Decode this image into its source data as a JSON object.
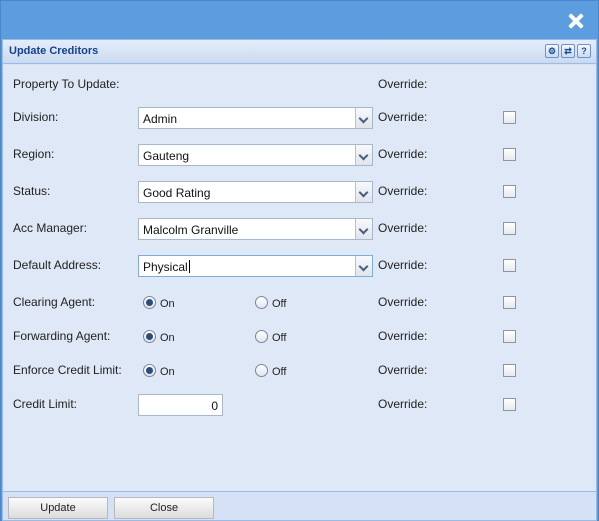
{
  "window": {
    "close_icon": "close-icon"
  },
  "panel": {
    "title": "Update Creditors",
    "tools": [
      {
        "icon": "gear-icon",
        "glyph": "⚙"
      },
      {
        "icon": "refresh-icon",
        "glyph": "⇄"
      },
      {
        "icon": "help-icon",
        "glyph": "?"
      }
    ]
  },
  "form": {
    "header_label": "Property To Update:",
    "override_label": "Override:",
    "division": {
      "label": "Division:",
      "value": "Admin"
    },
    "region": {
      "label": "Region:",
      "value": "Gauteng"
    },
    "status": {
      "label": "Status:",
      "value": "Good Rating"
    },
    "acc_manager": {
      "label": "Acc Manager:",
      "value": "Malcolm Granville"
    },
    "default_address": {
      "label": "Default Address:",
      "value": "Physical"
    },
    "clearing_agent": {
      "label": "Clearing Agent:",
      "on": "On",
      "off": "Off",
      "selected": "On"
    },
    "forwarding_agent": {
      "label": "Forwarding Agent:",
      "on": "On",
      "off": "Off",
      "selected": "On"
    },
    "enforce_credit_limit": {
      "label": "Enforce Credit Limit:",
      "on": "On",
      "off": "Off",
      "selected": "On"
    },
    "credit_limit": {
      "label": "Credit Limit:",
      "value": "0"
    }
  },
  "footer": {
    "update_label": "Update",
    "close_label": "Close"
  }
}
